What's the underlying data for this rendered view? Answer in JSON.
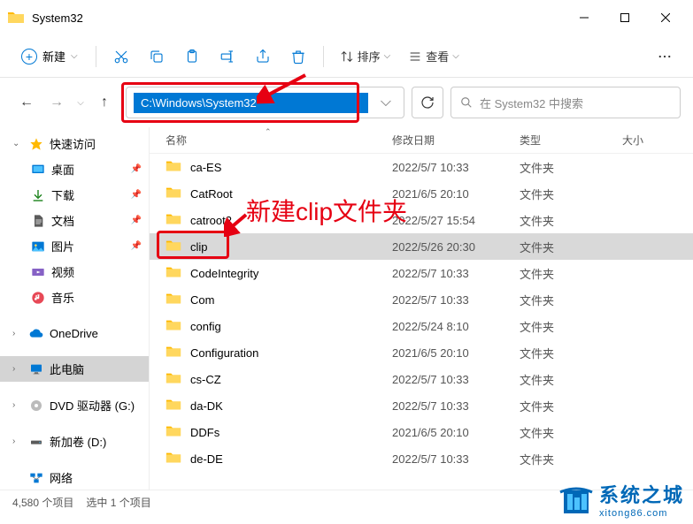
{
  "window": {
    "title": "System32"
  },
  "toolbar": {
    "new_label": "新建",
    "sort_label": "排序",
    "view_label": "查看"
  },
  "address": {
    "path": "C:\\Windows\\System32"
  },
  "search": {
    "placeholder": "在 System32 中搜索"
  },
  "sidebar": {
    "quick_access": "快速访问",
    "desktop": "桌面",
    "downloads": "下载",
    "documents": "文档",
    "pictures": "图片",
    "videos": "视频",
    "music": "音乐",
    "onedrive": "OneDrive",
    "this_pc": "此电脑",
    "dvd": "DVD 驱动器 (G:)",
    "newvol": "新加卷 (D:)",
    "network": "网络"
  },
  "columns": {
    "name": "名称",
    "date": "修改日期",
    "type": "类型",
    "size": "大小"
  },
  "files": [
    {
      "name": "ca-ES",
      "date": "2022/5/7 10:33",
      "type": "文件夹"
    },
    {
      "name": "CatRoot",
      "date": "2021/6/5 20:10",
      "type": "文件夹"
    },
    {
      "name": "catroot2",
      "date": "2022/5/27 15:54",
      "type": "文件夹"
    },
    {
      "name": "clip",
      "date": "2022/5/26 20:30",
      "type": "文件夹",
      "selected": true,
      "highlighted": true
    },
    {
      "name": "CodeIntegrity",
      "date": "2022/5/7 10:33",
      "type": "文件夹"
    },
    {
      "name": "Com",
      "date": "2022/5/7 10:33",
      "type": "文件夹"
    },
    {
      "name": "config",
      "date": "2022/5/24 8:10",
      "type": "文件夹"
    },
    {
      "name": "Configuration",
      "date": "2021/6/5 20:10",
      "type": "文件夹"
    },
    {
      "name": "cs-CZ",
      "date": "2022/5/7 10:33",
      "type": "文件夹"
    },
    {
      "name": "da-DK",
      "date": "2022/5/7 10:33",
      "type": "文件夹"
    },
    {
      "name": "DDFs",
      "date": "2021/6/5 20:10",
      "type": "文件夹"
    },
    {
      "name": "de-DE",
      "date": "2022/5/7 10:33",
      "type": "文件夹"
    }
  ],
  "status": {
    "count": "4,580 个项目",
    "selected": "选中 1 个项目"
  },
  "annotation": {
    "text": "新建clip文件夹"
  },
  "watermark": {
    "main": "系统之城",
    "sub": "xitong86.com"
  }
}
